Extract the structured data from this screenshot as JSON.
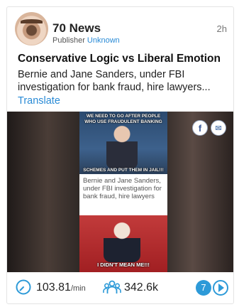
{
  "card": {
    "publisher": {
      "name": "70 News",
      "role_label": "Publisher",
      "status": "Unknown"
    },
    "time_ago": "2h",
    "title": "Conservative Logic vs Liberal Emotion",
    "description": "Bernie and Jane Sanders, under FBI investigation for bank fraud, hire lawyers...",
    "translate_label": "Translate",
    "media": {
      "caption_top": "WE NEED TO GO AFTER PEOPLE WHO USE FRAUDULENT BANKING",
      "caption_mid": "SCHEMES AND PUT THEM IN JAIL!!!",
      "caption_text": "Bernie and Jane Sanders, under FBI investigation for bank fraud, hire lawyers",
      "caption_bottom": "I DIDN'T MEAN ME!!!",
      "share_fb": "f",
      "share_mail": "✉"
    },
    "stats": {
      "rate_value": "103.81",
      "rate_unit": "/min",
      "reach_value": "342.6k",
      "count": "7"
    },
    "icons": {
      "rate": "speedometer-icon",
      "reach": "users-icon",
      "play": "play-icon"
    },
    "colors": {
      "accent": "#2d9ad8",
      "link": "#2a8bd6"
    }
  }
}
